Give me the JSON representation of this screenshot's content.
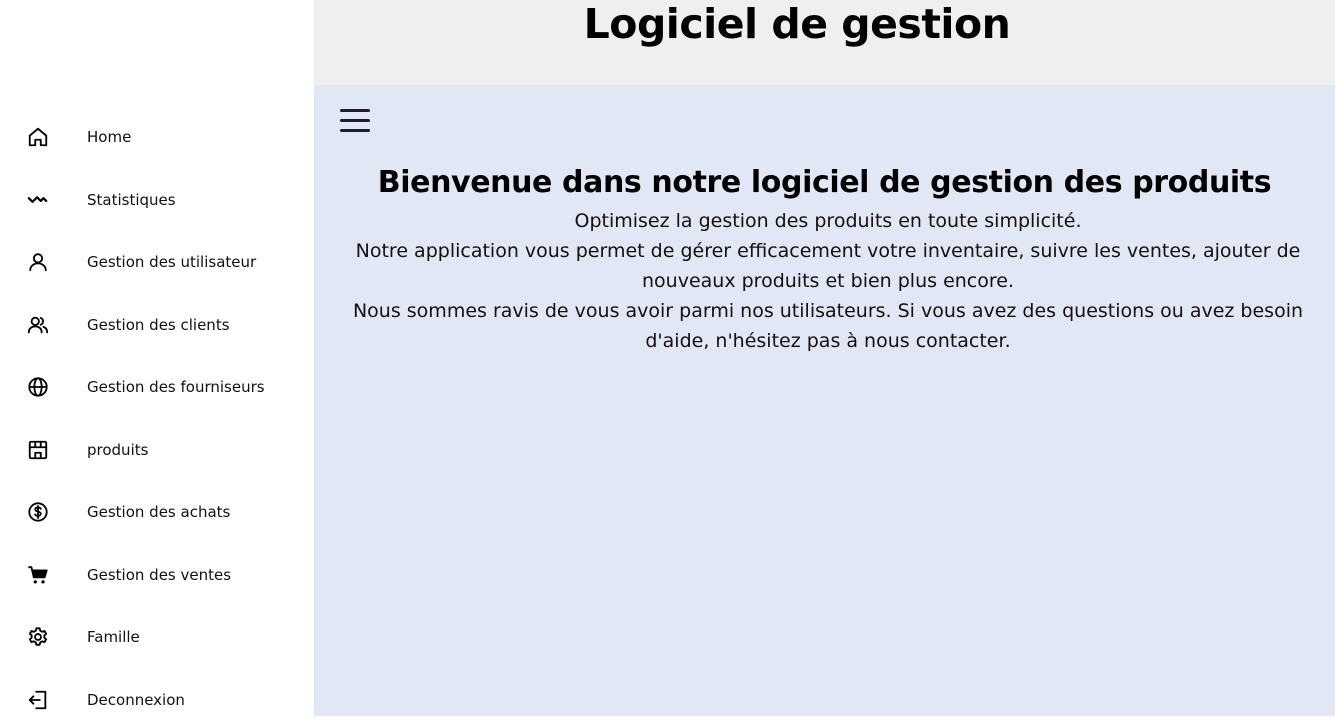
{
  "header": {
    "title": "Logiciel de gestion"
  },
  "sidebar": {
    "items": [
      {
        "label": "Home",
        "icon": "home-icon"
      },
      {
        "label": "Statistiques",
        "icon": "activity-icon"
      },
      {
        "label": "Gestion des utilisateur",
        "icon": "user-icon"
      },
      {
        "label": "Gestion des clients",
        "icon": "users-icon"
      },
      {
        "label": "Gestion des fourniseurs",
        "icon": "globe-icon"
      },
      {
        "label": "produits",
        "icon": "store-icon"
      },
      {
        "label": "Gestion des achats",
        "icon": "dollar-circle-icon"
      },
      {
        "label": "Gestion des ventes",
        "icon": "cart-icon"
      },
      {
        "label": "Famille",
        "icon": "gear-icon"
      },
      {
        "label": "Deconnexion",
        "icon": "logout-icon"
      }
    ]
  },
  "main": {
    "welcome_title": "Bienvenue dans notre logiciel de gestion des produits",
    "paragraphs": [
      "Optimisez la gestion des produits en toute simplicité.",
      "Notre application vous permet de gérer efficacement votre inventaire, suivre les ventes, ajouter de nouveaux produits et bien plus encore.",
      "Nous sommes ravis de vous avoir parmi nos utilisateurs. Si vous avez des questions ou avez besoin d'aide, n'hésitez pas à nous contacter."
    ]
  },
  "colors": {
    "header_bg": "#efefef",
    "main_bg": "#e2e7f5",
    "sidebar_bg": "#ffffff"
  }
}
